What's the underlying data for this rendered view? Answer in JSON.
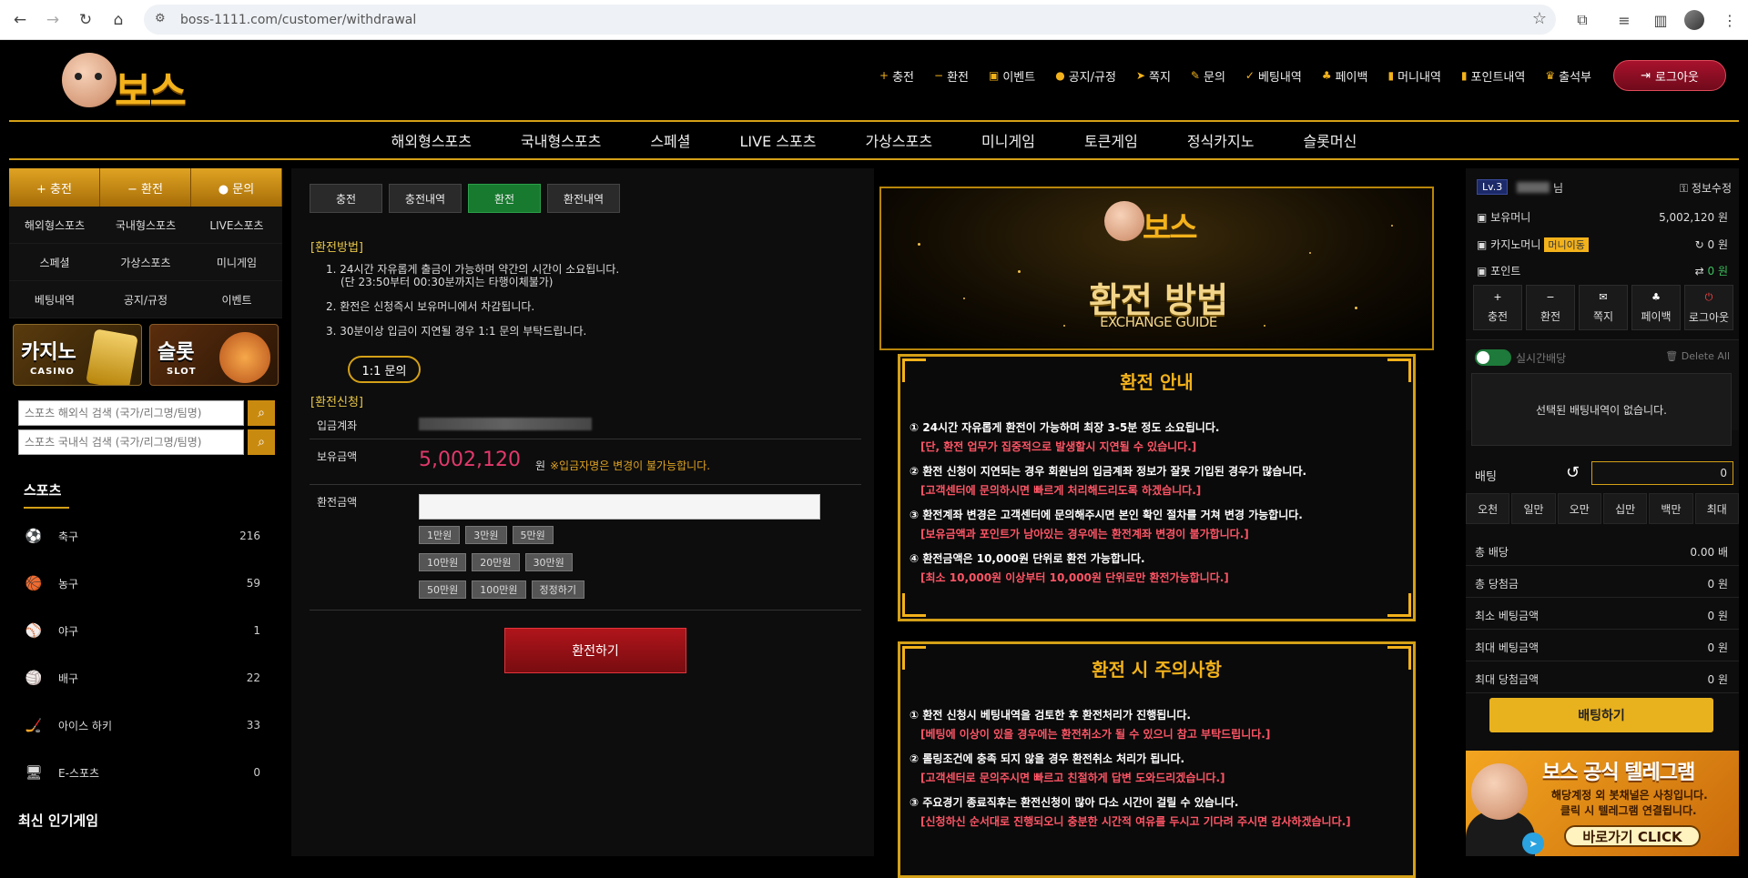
{
  "browser": {
    "url": "boss-1111.com/customer/withdrawal"
  },
  "header": {
    "logo_text": "보스",
    "menu": [
      {
        "icon": "+",
        "label": "충전"
      },
      {
        "icon": "−",
        "label": "환전"
      },
      {
        "icon": "▣",
        "label": "이벤트"
      },
      {
        "icon": "●",
        "label": "공지/규정"
      },
      {
        "icon": "➤",
        "label": "쪽지"
      },
      {
        "icon": "✎",
        "label": "문의"
      },
      {
        "icon": "✓",
        "label": "베팅내역"
      },
      {
        "icon": "♣",
        "label": "페이백"
      },
      {
        "icon": "▮",
        "label": "머니내역"
      },
      {
        "icon": "▮",
        "label": "포인트내역"
      },
      {
        "icon": "♛",
        "label": "출석부"
      }
    ],
    "logout_label": "로그아웃"
  },
  "mainnav": [
    "해외형스포츠",
    "국내형스포츠",
    "스페셜",
    "LIVE 스포츠",
    "가상스포츠",
    "미니게임",
    "토큰게임",
    "정식카지노",
    "슬롯머신"
  ],
  "leftbar": {
    "top_buttons": [
      "+ 충전",
      "− 환전",
      "● 문의"
    ],
    "grid": [
      "해외형스포츠",
      "국내형스포츠",
      "LIVE스포츠",
      "스페셜",
      "가상스포츠",
      "미니게임",
      "베팅내역",
      "공지/규정",
      "이벤트"
    ],
    "banner_casino": {
      "title": "카지노",
      "sub": "CASINO"
    },
    "banner_slot": {
      "title": "슬롯",
      "sub": "SLOT"
    },
    "search_overseas_placeholder": "스포츠 해외식 검색 (국가/리그명/팀명)",
    "search_domestic_placeholder": "스포츠 국내식 검색 (국가/리그명/팀명)",
    "sports_title": "스포츠",
    "sports": [
      {
        "name": "축구",
        "count": "216",
        "icon": "⚽"
      },
      {
        "name": "농구",
        "count": "59",
        "icon": "🏀"
      },
      {
        "name": "야구",
        "count": "1",
        "icon": "⚾"
      },
      {
        "name": "배구",
        "count": "22",
        "icon": "🏐"
      },
      {
        "name": "아이스 하키",
        "count": "33",
        "icon": "🏒"
      },
      {
        "name": "E-스포츠",
        "count": "0",
        "icon": "🖥"
      }
    ],
    "hot_title": "최신 인기게임"
  },
  "center": {
    "tabs": [
      "충전",
      "충전내역",
      "환전",
      "환전내역"
    ],
    "method_title": "[환전방법]",
    "method_lines": [
      "1. 24시간 자유롭게 출금이 가능하며 약간의 시간이 소요됩니다.",
      "(단 23:50부터 00:30분까지는 타행이체불가)",
      "2. 환전은 신청즉시 보유머니에서 차감됩니다.",
      "3. 30분이상 입금이 지연될 경우 1:1 문의 부탁드립니다."
    ],
    "inquiry_button": "1:1 문의",
    "request_title": "[환전신청]",
    "account_label": "입금계좌",
    "balance_label": "보유금액",
    "balance_value": "5,002,120",
    "balance_unit": "원",
    "balance_note": "※입금자명은 변경이 불가능합니다.",
    "amount_label": "환전금액",
    "chips": [
      [
        "1만원",
        "3만원",
        "5만원"
      ],
      [
        "10만원",
        "20만원",
        "30만원"
      ],
      [
        "50만원",
        "100만원",
        "정정하기"
      ]
    ],
    "submit_label": "환전하기"
  },
  "guide": {
    "logo_text": "보스",
    "title": "환전 방법",
    "subtitle": "EXCHANGE GUIDE",
    "box1": {
      "header": "환전 안내",
      "items": [
        {
          "main": "① 24시간 자유롭게 환전이 가능하며 최장 3-5분 정도 소요됩니다.",
          "sub": "[단, 환전 업무가 집중적으로 발생할시 지연될 수 있습니다.]"
        },
        {
          "main": "② 환전 신청이 지연되는 경우 회원님의 입금계좌 정보가 잘못 기입된 경우가 많습니다.",
          "sub": "[고객센터에 문의하시면 빠르게 처리해드리도록 하겠습니다.]"
        },
        {
          "main": "③ 환전계좌 변경은 고객센터에 문의해주시면 본인 확인 절차를 거쳐 변경 가능합니다.",
          "sub": "[보유금액과 포인트가 남아있는 경우에는 환전계좌 변경이 불가합니다.]"
        },
        {
          "main": "④ 환전금액은 10,000원 단위로 환전 가능합니다.",
          "sub": "[최소 10,000원 이상부터 10,000원 단위로만 환전가능합니다.]"
        }
      ]
    },
    "box2": {
      "header": "환전 시 주의사항",
      "items": [
        {
          "main": "① 환전 신청시 베팅내역을 검토한 후 환전처리가 진행됩니다.",
          "sub": "[베팅에 이상이 있을 경우에는 환전취소가 될 수 있으니 참고 부탁드립니다.]"
        },
        {
          "main": "② 롤링조건에 충족 되지 않을 경우 환전취소 처리가 됩니다.",
          "sub": "[고객센터로 문의주시면 빠르고 친절하게 답변 도와드리겠습니다.]"
        },
        {
          "main": "③ 주요경기 종료직후는 환전신청이 많아 다소 시간이 걸릴 수 있습니다.",
          "sub": "[신청하신 순서대로 진행되오니 충분한 시간적 여유를 두시고 기다려 주시면 감사하겠습니다.]"
        }
      ]
    }
  },
  "rightbar": {
    "level": "Lv.3",
    "nim": "님",
    "info_edit": "정보수정",
    "money_label": "보유머니",
    "money_value": "5,002,120 원",
    "casino_label": "카지노머니",
    "casino_badge": "머니이동",
    "casino_value": "0 원",
    "point_label": "포인트",
    "point_value": "0 원",
    "buttons": [
      {
        "icon": "+",
        "label": "충전"
      },
      {
        "icon": "−",
        "label": "환전"
      },
      {
        "icon": "✉",
        "label": "쪽지"
      },
      {
        "icon": "♣",
        "label": "페이백"
      },
      {
        "icon": "⏻",
        "label": "로그아웃"
      }
    ],
    "live_label": "실시간배당",
    "delete_all": "Delete All",
    "no_bet": "선택된 배팅내역이 없습니다.",
    "bet_label": "배팅",
    "bet_value": "0",
    "bet_amounts": [
      "오천",
      "일만",
      "오만",
      "십만",
      "백만",
      "최대"
    ],
    "stats": [
      {
        "label": "총 배당",
        "value": "0.00 배"
      },
      {
        "label": "총 당첨금",
        "value": "0 원"
      },
      {
        "label": "최소 베팅금액",
        "value": "0 원"
      },
      {
        "label": "최대 베팅금액",
        "value": "0 원"
      },
      {
        "label": "최대 당첨금액",
        "value": "0 원"
      }
    ],
    "bet_button": "배팅하기",
    "telegram": {
      "title": "보스 공식 텔레그램",
      "line1": "해당계정 외 봇채널은 사칭입니다.",
      "line2": "클릭 시 텔레그램 연결됩니다.",
      "cta": "바로가기 CLICK"
    }
  }
}
